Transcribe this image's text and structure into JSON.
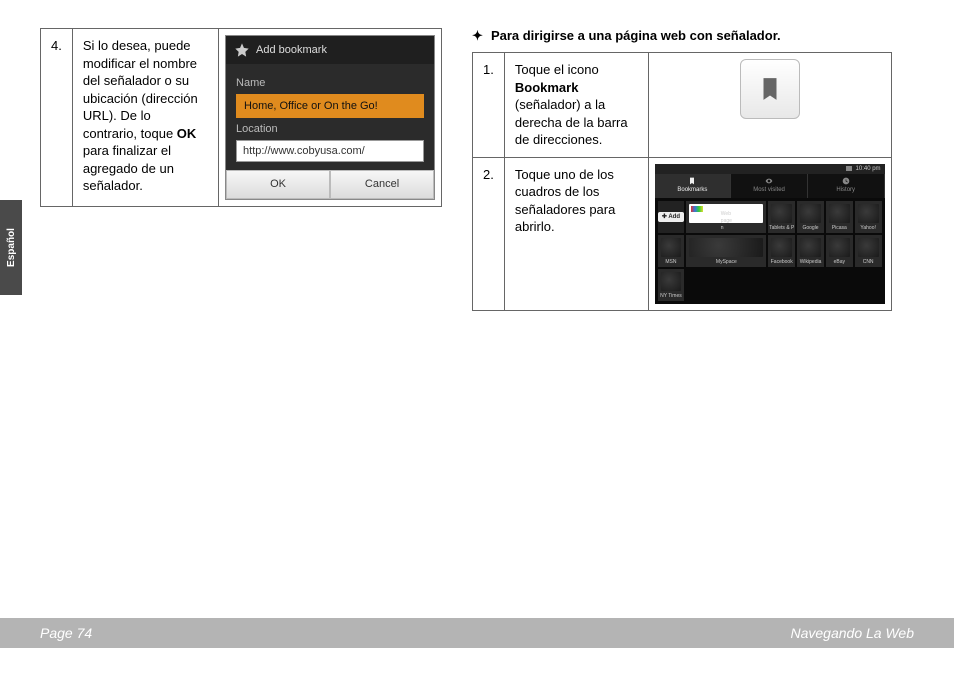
{
  "lang_tab": "Español",
  "footer": {
    "page": "Page 74",
    "section": "Navegando La Web"
  },
  "left": {
    "step_num": "4.",
    "step_text_a": "Si lo desea, puede modificar el nombre del señalador o su ubicación (dirección URL). De lo contrario, toque ",
    "step_text_bold": "OK",
    "step_text_b": " para finalizar el agregado de un señalador.",
    "dlg": {
      "title": "Add bookmark",
      "name_label": "Name",
      "name_value": "Home, Office or On the Go!",
      "loc_label": "Location",
      "loc_value": "http://www.cobyusa.com/",
      "ok": "OK",
      "cancel": "Cancel"
    }
  },
  "right": {
    "heading": "Para dirigirse a una página web con señalador.",
    "row1": {
      "num": "1.",
      "a": "Toque el icono ",
      "bold": "Bookmark",
      "b": " (señalador) a la derecha de la barra de direcciones."
    },
    "row2": {
      "num": "2.",
      "text": "Toque uno de los cuadros de los señaladores para abrirlo."
    },
    "screen": {
      "time": "10:40 pm",
      "tabs": {
        "bookmarks": "Bookmarks",
        "most": "Most visited",
        "history": "History"
      },
      "add": "Add",
      "cells": [
        "Web page n",
        "Tablets & P",
        "Google",
        "Picasa",
        "Yahoo!",
        "MSN",
        "MySpace",
        "Facebook",
        "Wikipedia",
        "eBay",
        "CNN",
        "NY Times"
      ]
    }
  }
}
